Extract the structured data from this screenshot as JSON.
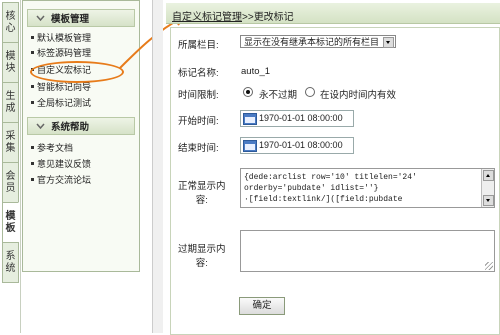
{
  "vertical_tabs": [
    "核心",
    "模块",
    "生成",
    "采集",
    "会员",
    "模板",
    "系统"
  ],
  "sidebar": {
    "sections": [
      {
        "title": "模板管理",
        "items": [
          "默认模板管理",
          "标签源码管理",
          "自定义宏标记",
          "智能标记向导",
          "全局标记测试"
        ]
      },
      {
        "title": "系统帮助",
        "items": [
          "参考文档",
          "意见建议反馈",
          "官方交流论坛"
        ]
      }
    ]
  },
  "breadcrumb": {
    "title": "自定义标记管理",
    "sep": ">>",
    "current": "更改标记"
  },
  "form": {
    "column_label": "所属栏目:",
    "column_value": "显示在没有继承本标记的所有栏目",
    "name_label": "标记名称:",
    "name_value": "auto_1",
    "limit_label": "时间限制:",
    "limit_options": [
      "永不过期",
      "在设内时间内有效"
    ],
    "start_label": "开始时间:",
    "start_value": "1970-01-01 08:00:00",
    "end_label": "结束时间:",
    "end_value": "1970-01-01 08:00:00",
    "normal_label_1": "正常显示内",
    "normal_label_2": "容:",
    "normal_content": "{dede:arclist row='10' titlelen='24'\norderby='pubdate' idlist=''}\n·[field:textlink/]([field:pubdate",
    "expired_label_1": "过期显示内",
    "expired_label_2": "容:",
    "expired_content": "",
    "submit_label": "确定"
  },
  "colors": {
    "accent": "#e77b1a",
    "header_green": "#d6e2c8"
  }
}
